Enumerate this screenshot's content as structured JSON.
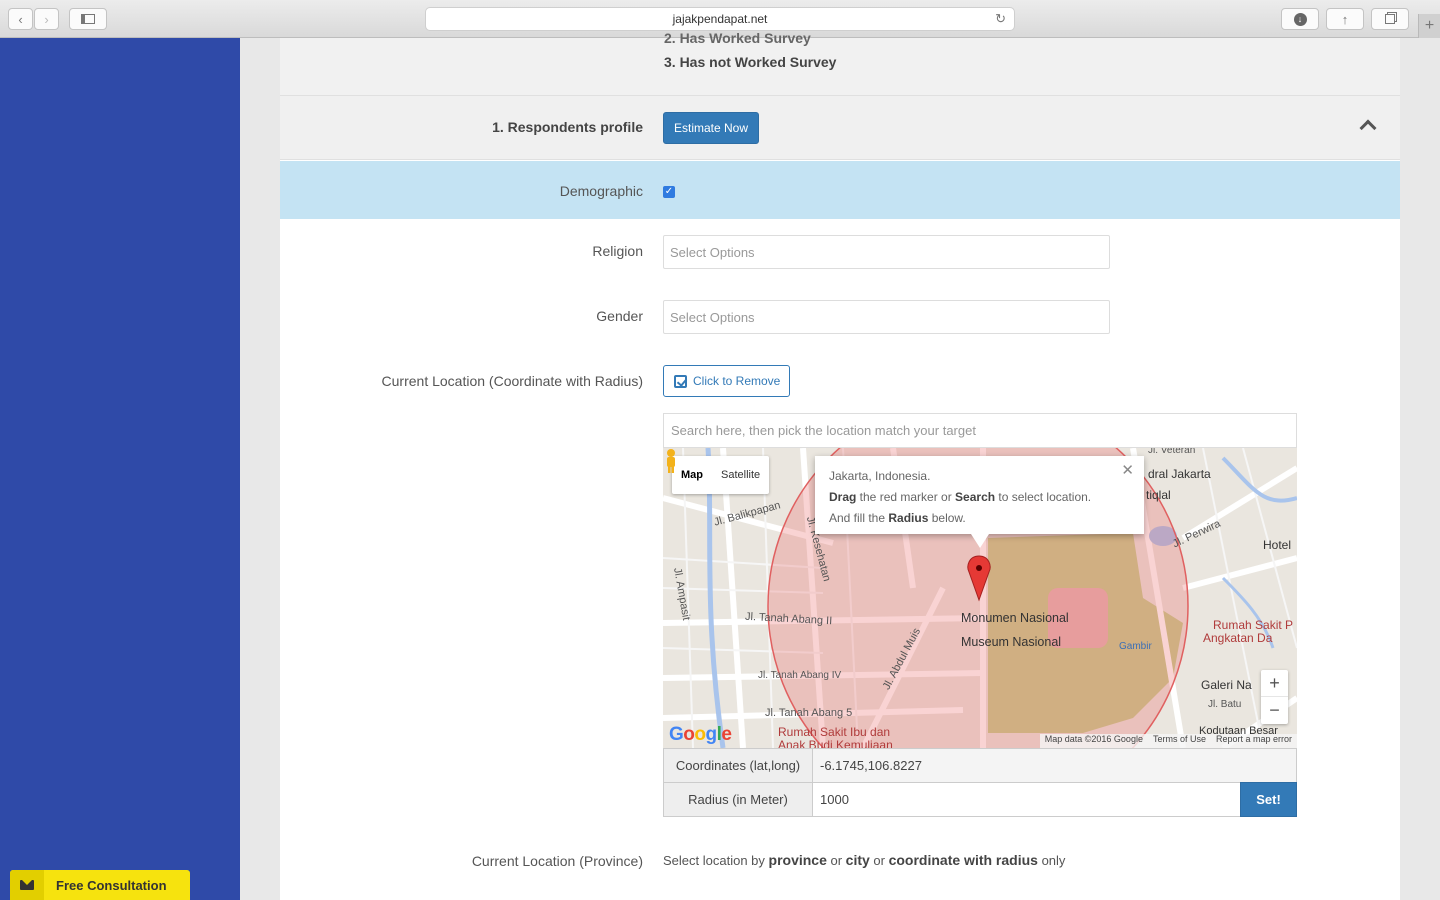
{
  "browser": {
    "url": "jajakpendapat.net"
  },
  "sidebar": {
    "consult_label": "Free Consultation"
  },
  "survey_list": {
    "item2": "2.  Has Worked Survey",
    "item3": "3.  Has not Worked Survey"
  },
  "respondents": {
    "label": "1. Respondents profile",
    "estimate_button": "Estimate Now"
  },
  "demographic": {
    "label": "Demographic",
    "checked": true
  },
  "religion": {
    "label": "Religion",
    "placeholder": "Select Options"
  },
  "gender": {
    "label": "Gender",
    "placeholder": "Select Options"
  },
  "location": {
    "label": "Current Location (Coordinate with Radius)",
    "remove_button": "Click to Remove",
    "search_placeholder": "Search here, then pick the location match your target"
  },
  "map": {
    "type_map": "Map",
    "type_satellite": "Satellite",
    "info_title": "Jakarta, Indonesia.",
    "info_line1_a": "Drag",
    "info_line1_b": " the red marker or ",
    "info_line1_c": "Search",
    "info_line1_d": " to select location.",
    "info_line2_a": "And fill the ",
    "info_line2_b": "Radius",
    "info_line2_c": " below.",
    "zoom_in": "+",
    "zoom_out": "−",
    "footer_data": "Map data ©2016 Google",
    "footer_terms": "Terms of Use",
    "footer_report": "Report a map error",
    "labels": {
      "monumen": "Monumen Nasional",
      "museum": "Museum Nasional",
      "balikpapan": "Jl. Balikpapan",
      "kesehatan": "Jl. Kesehatan",
      "ampasit": "Jl. Ampasit",
      "tanah2": "Jl. Tanah Abang II",
      "tanah4": "Jl. Tanah Abang IV",
      "tanah5": "Jl. Tanah Abang 5",
      "abdulmuis": "Jl. Abdul Muis",
      "perwira": "Jl. Perwira",
      "hotel": "Hotel",
      "gambir": "Gambir",
      "rumahsakit": "Rumah Sakit Ibu dan",
      "anakbudi": "Anak Budi Kemuliaan",
      "rsp": "Rumah Sakit P",
      "angkatan": "Angkatan Da",
      "galeri": "Galeri Na",
      "batu": "Jl. Batu",
      "kodutaan": "Kodutaan Besar",
      "jakarta": "dral Jakarta",
      "tiqlal": "tiqlal",
      "veteran": "Jl. Veteran"
    }
  },
  "coordinates": {
    "label": "Coordinates (lat,long)",
    "value": "-6.1745,106.8227"
  },
  "radius": {
    "label": "Radius (in Meter)",
    "value": "1000",
    "set_button": "Set!"
  },
  "province": {
    "label": "Current Location (Province)",
    "text_a": "Select location by ",
    "text_b": "province",
    "text_c": " or ",
    "text_d": "city",
    "text_e": " or ",
    "text_f": "coordinate with radius",
    "text_g": " only"
  },
  "colors": {
    "sidebar": "#2f4aa8",
    "primary": "#337ab7",
    "highlight_row": "#c4e3f3",
    "consult": "#f6e30e",
    "radius_circle": "#e06060"
  }
}
